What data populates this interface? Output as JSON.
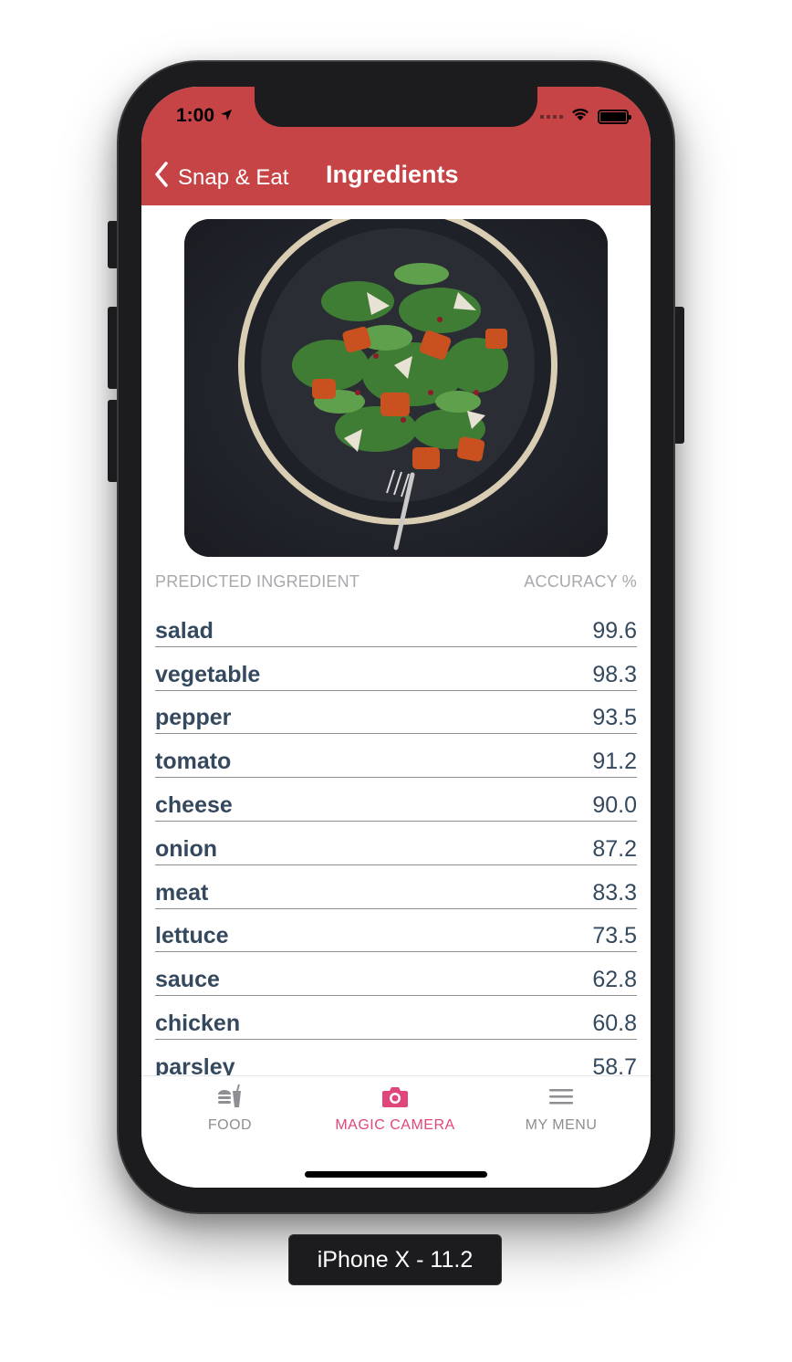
{
  "status_bar": {
    "time": "1:00"
  },
  "nav": {
    "back_label": "Snap & Eat",
    "title": "Ingredients"
  },
  "photo": {
    "subject": "salad-plate-photo"
  },
  "table": {
    "header_ingredient": "PREDICTED INGREDIENT",
    "header_accuracy": "ACCURACY %",
    "rows": [
      {
        "name": "salad",
        "accuracy": "99.6"
      },
      {
        "name": "vegetable",
        "accuracy": "98.3"
      },
      {
        "name": "pepper",
        "accuracy": "93.5"
      },
      {
        "name": "tomato",
        "accuracy": "91.2"
      },
      {
        "name": "cheese",
        "accuracy": "90.0"
      },
      {
        "name": "onion",
        "accuracy": "87.2"
      },
      {
        "name": "meat",
        "accuracy": "83.3"
      },
      {
        "name": "lettuce",
        "accuracy": "73.5"
      },
      {
        "name": "sauce",
        "accuracy": "62.8"
      },
      {
        "name": "chicken",
        "accuracy": "60.8"
      },
      {
        "name": "parsley",
        "accuracy": "58.7"
      }
    ]
  },
  "tabbar": {
    "items": [
      {
        "label": "FOOD",
        "icon": "food-icon"
      },
      {
        "label": "MAGIC CAMERA",
        "icon": "camera-icon"
      },
      {
        "label": "MY MENU",
        "icon": "menu-icon"
      }
    ],
    "active": "MAGIC CAMERA"
  },
  "device_label": "iPhone X - 11.2",
  "colors": {
    "header": "#c64346",
    "accent": "#e0457b",
    "row_text": "#34495e",
    "muted": "#a8a8ad"
  }
}
